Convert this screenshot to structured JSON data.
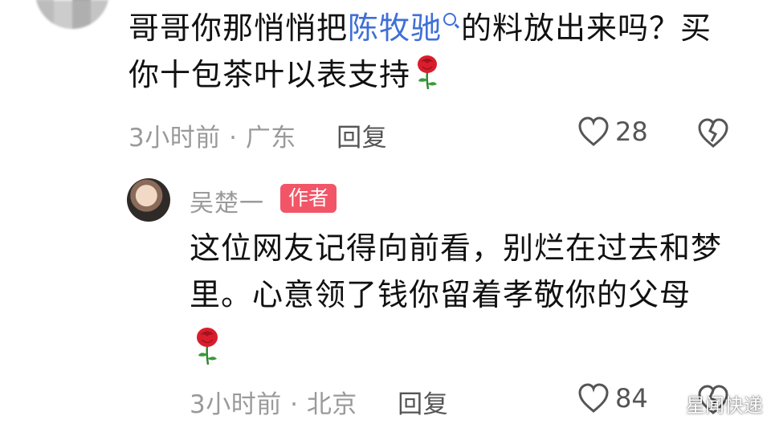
{
  "comment": {
    "text_before": "哥哥你那悄悄把",
    "mention": "陈牧驰",
    "text_after": "的料放出来吗？买你十包茶叶以表支持",
    "emoji_icon": "rose-icon",
    "time": "3小时前",
    "separator": "·",
    "location": "广东",
    "reply_label": "回复",
    "like_count": "28"
  },
  "reply": {
    "author_name": "吴楚一",
    "author_badge": "作者",
    "text": "这位网友记得向前看，别烂在过去和梦里。心意领了钱你留着孝敬你的父母",
    "emoji_icon": "rose-icon",
    "time": "3小时前",
    "separator": "·",
    "location": "北京",
    "reply_label": "回复",
    "like_count": "84"
  },
  "watermark": {
    "text": "星闻快递"
  },
  "colors": {
    "link": "#3f6fd8",
    "badge": "#f25567",
    "meta": "#9a9a9a",
    "rose": "#d81e2c"
  }
}
